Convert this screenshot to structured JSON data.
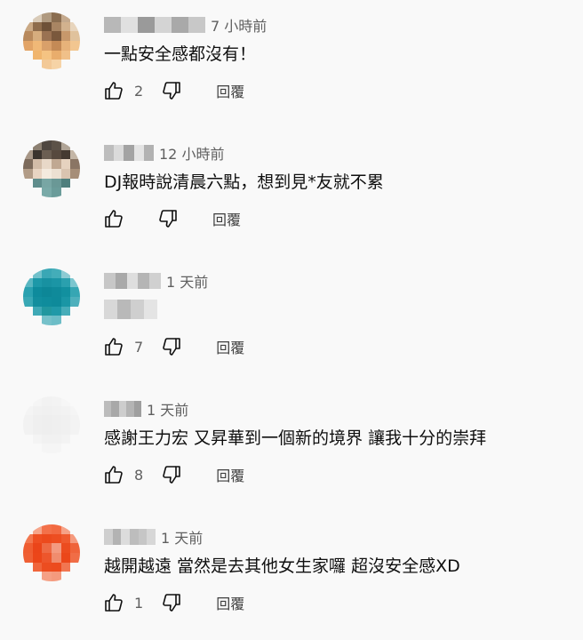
{
  "comments": [
    {
      "time": "7 小時前",
      "text": "一點安全感都沒有！",
      "likes": "2",
      "reply_label": "回覆",
      "author_colors": [
        "#b8b8b8",
        "#e0e0e0",
        "#9a9a9a",
        "#d4d4d4",
        "#a9a9a9",
        "#c8c8c8"
      ],
      "avatar_colors": [
        "#f9f9f9",
        "#d9cbb8",
        "#b09a80",
        "#8a6d50",
        "#c4a98d",
        "#f9f9f9",
        "#caa985",
        "#8e6c4c",
        "#6e5138",
        "#a88563",
        "#d2b28e",
        "#e8d5bd",
        "#b8895c",
        "#d6ad7e",
        "#9a7252",
        "#7a583c",
        "#c7986b",
        "#e0c29c",
        "#e2a467",
        "#f0b877",
        "#d9a06a",
        "#c48a56",
        "#e7b27a",
        "#f2c690",
        "#f9f9f9",
        "#f0b56e",
        "#f5c382",
        "#e9ad6c",
        "#f0c089",
        "#f9f9f9",
        "#f9f9f9",
        "#f9f9f9",
        "#f3c997",
        "#f6d3a6",
        "#f9f9f9",
        "#f9f9f9"
      ]
    },
    {
      "time": "12 小時前",
      "text": "DJ報時說清晨六點，想到見*友就不累",
      "likes": "",
      "reply_label": "回覆",
      "author_colors": [
        "#bdbdbd",
        "#dadada",
        "#a3a3a3",
        "#e4e4e4",
        "#b2b2b2"
      ],
      "avatar_colors": [
        "#f9f9f9",
        "#8c8072",
        "#4f4740",
        "#5c5248",
        "#b0a496",
        "#f9f9f9",
        "#a89787",
        "#3b342e",
        "#6b5e52",
        "#57493e",
        "#453a31",
        "#c4b6a6",
        "#7c6a5b",
        "#d2bca8",
        "#e8d8c8",
        "#c0a892",
        "#e6d2bf",
        "#8a7564",
        "#b29c87",
        "#e8d4c2",
        "#f4eade",
        "#ece0d2",
        "#d9c4b0",
        "#a68e78",
        "#f9f9f9",
        "#5f8d8c",
        "#78a6a4",
        "#6a9896",
        "#4f7f7d",
        "#f9f9f9",
        "#f9f9f9",
        "#f9f9f9",
        "#7aaaa8",
        "#6b9c9a",
        "#f9f9f9",
        "#f9f9f9"
      ]
    },
    {
      "time": "1 天前",
      "text": "",
      "likes": "7",
      "reply_label": "回覆",
      "author_colors": [
        "#c7c7c7",
        "#a9a9a9",
        "#dedede",
        "#b5b5b5",
        "#d0d0d0"
      ],
      "text_colors": [
        "#d8d8d8",
        "#b9b9b9",
        "#cfcfcf",
        "#e4e4e4"
      ],
      "avatar_colors": [
        "#f9f9f9",
        "#72c1cb",
        "#3aa7b5",
        "#43adb9",
        "#8ccbd3",
        "#f9f9f9",
        "#59b6c1",
        "#1d98a8",
        "#1891a1",
        "#1b95a5",
        "#2aa0ae",
        "#7cc6cf",
        "#2aa1b0",
        "#0e8b9c",
        "#0d8797",
        "#0f8a9a",
        "#12909f",
        "#36a6b3",
        "#39a8b5",
        "#128e9e",
        "#0f8c9c",
        "#0e8a9a",
        "#1a96a5",
        "#4eb0bc",
        "#f9f9f9",
        "#3fa9b6",
        "#21979f",
        "#2099a8",
        "#47adb9",
        "#f9f9f9",
        "#f9f9f9",
        "#f9f9f9",
        "#76c1ca",
        "#6dbdc7",
        "#f9f9f9",
        "#f9f9f9"
      ]
    },
    {
      "time": "1 天前",
      "text": "感謝王力宏 又昇華到一個新的境界 讓我十分的崇拜",
      "likes": "8",
      "reply_label": "回覆",
      "author_colors": [
        "#bcbcbc",
        "#a8a8a8",
        "#cdcdcd",
        "#b4b4b4",
        "#9f9f9f"
      ],
      "avatar_colors": [
        "#f9f9f9",
        "#f5f5f5",
        "#f2f2f2",
        "#f3f3f3",
        "#f6f6f6",
        "#f9f9f9",
        "#f4f4f4",
        "#f1f1f1",
        "#f0f0f0",
        "#f1f1f1",
        "#f2f2f2",
        "#f5f5f5",
        "#f2f2f2",
        "#efefef",
        "#eeeeee",
        "#efefef",
        "#f0f0f0",
        "#f3f3f3",
        "#f2f2f2",
        "#efefef",
        "#eeeeee",
        "#efefef",
        "#f0f0f0",
        "#f3f3f3",
        "#f9f9f9",
        "#f4f4f4",
        "#f1f1f1",
        "#f1f1f1",
        "#f3f3f3",
        "#f9f9f9",
        "#f9f9f9",
        "#f9f9f9",
        "#f5f5f5",
        "#f5f5f5",
        "#f9f9f9",
        "#f9f9f9"
      ]
    },
    {
      "time": "1 天前",
      "text": "越開越遠 當然是去其他女生家囉  超沒安全感XD",
      "likes": "1",
      "reply_label": "回覆",
      "author_colors": [
        "#cfcfcf",
        "#b3b3b3",
        "#dcdcdc",
        "#bdbdbd",
        "#c6c6c6",
        "#d7d7d7"
      ],
      "avatar_colors": [
        "#f9f9f9",
        "#f6a58a",
        "#f3714a",
        "#f26a42",
        "#f6a287",
        "#f9f9f9",
        "#f2774f",
        "#ee4f22",
        "#ec4a1d",
        "#ed4e21",
        "#ef5a2e",
        "#f59a7e",
        "#ef5d31",
        "#eb4519",
        "#ee6a44",
        "#f39a80",
        "#ec4c1f",
        "#ef633a",
        "#ef5f34",
        "#ec4619",
        "#ed562c",
        "#f08c6e",
        "#eb471a",
        "#f06d46",
        "#f9f9f9",
        "#f0653b",
        "#ec4d20",
        "#ec4b1e",
        "#f17651",
        "#f9f9f9",
        "#f9f9f9",
        "#f9f9f9",
        "#f5a085",
        "#f49a7e",
        "#f9f9f9",
        "#f9f9f9"
      ]
    }
  ]
}
